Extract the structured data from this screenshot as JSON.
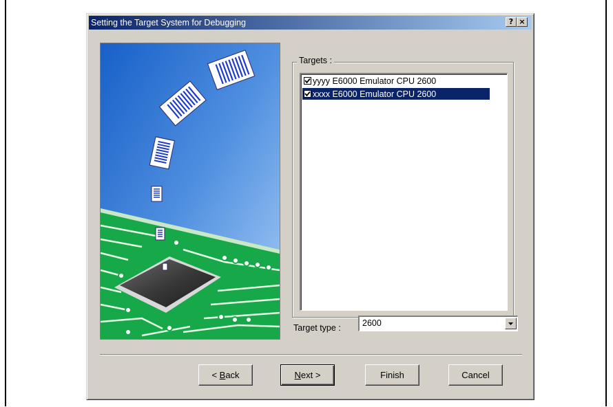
{
  "window": {
    "title": "Setting the Target System for Debugging",
    "help_glyph": "?",
    "close_glyph": "×"
  },
  "targets": {
    "label": "Targets :",
    "items": [
      {
        "label": "yyyy E6000 Emulator CPU 2600",
        "checked": true,
        "selected": false
      },
      {
        "label": "xxxx E6000 Emulator CPU 2600",
        "checked": true,
        "selected": true
      }
    ]
  },
  "target_type": {
    "label": "Target type :",
    "value": "2600"
  },
  "buttons": {
    "back": {
      "prefix": "< ",
      "accel": "B",
      "rest": "ack"
    },
    "next": {
      "accel": "N",
      "rest": "ext >"
    },
    "finish": "Finish",
    "cancel": "Cancel"
  },
  "colors": {
    "titlebar_start": "#0a246a",
    "titlebar_end": "#a6caf0",
    "selection": "#0a246a",
    "face": "#d4d0c8"
  }
}
